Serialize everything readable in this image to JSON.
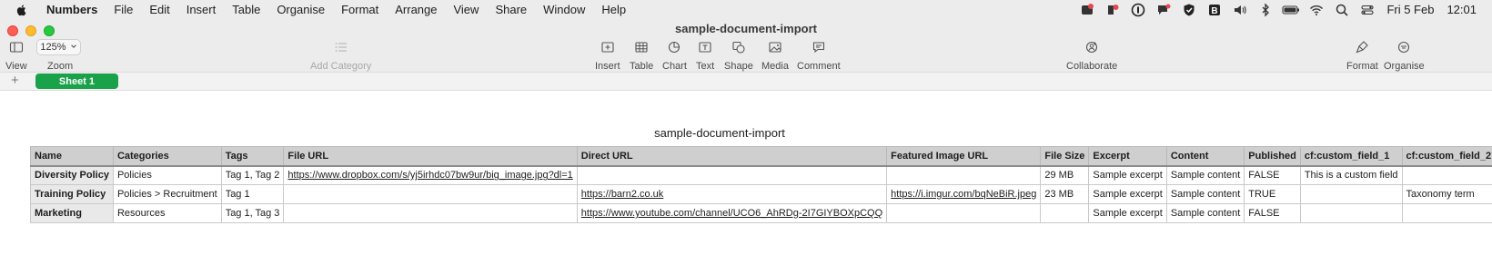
{
  "menubar": {
    "app": "Numbers",
    "items": [
      "File",
      "Edit",
      "Insert",
      "Table",
      "Organise",
      "Format",
      "Arrange",
      "View",
      "Share",
      "Window",
      "Help"
    ],
    "date": "Fri 5 Feb",
    "time": "12:01"
  },
  "window": {
    "title": "sample-document-import"
  },
  "toolbar": {
    "view": "View",
    "zoom_value": "125%",
    "zoom": "Zoom",
    "add_category": "Add Category",
    "insert": "Insert",
    "table": "Table",
    "chart": "Chart",
    "text": "Text",
    "shape": "Shape",
    "media": "Media",
    "comment": "Comment",
    "collaborate": "Collaborate",
    "format": "Format",
    "organise": "Organise"
  },
  "sheets": {
    "add": "+",
    "active": "Sheet 1"
  },
  "table": {
    "title": "sample-document-import",
    "columns": [
      "Name",
      "Categories",
      "Tags",
      "File URL",
      "Direct URL",
      "Featured Image URL",
      "File Size",
      "Excerpt",
      "Content",
      "Published",
      "cf:custom_field_1",
      "cf:custom_field_2"
    ],
    "rows": [
      [
        "Diversity Policy",
        "Policies",
        "Tag 1, Tag 2",
        "https://www.dropbox.com/s/yj5irhdc07bw9ur/big_image.jpg?dl=1",
        "",
        "",
        "29 MB",
        "Sample excerpt",
        "Sample content",
        "FALSE",
        "This is a custom field",
        ""
      ],
      [
        "Training Policy",
        "Policies > Recruitment",
        "Tag 1",
        "",
        "https://barn2.co.uk",
        "https://i.imgur.com/bqNeBiR.jpeg",
        "23 MB",
        "Sample excerpt",
        "Sample content",
        "TRUE",
        "",
        "Taxonomy term"
      ],
      [
        "Marketing",
        "Resources",
        "Tag 1, Tag 3",
        "",
        "https://www.youtube.com/channel/UCO6_AhRDg-2I7GIYBOXpCQQ",
        "",
        "",
        "Sample excerpt",
        "Sample content",
        "FALSE",
        "",
        ""
      ]
    ]
  }
}
